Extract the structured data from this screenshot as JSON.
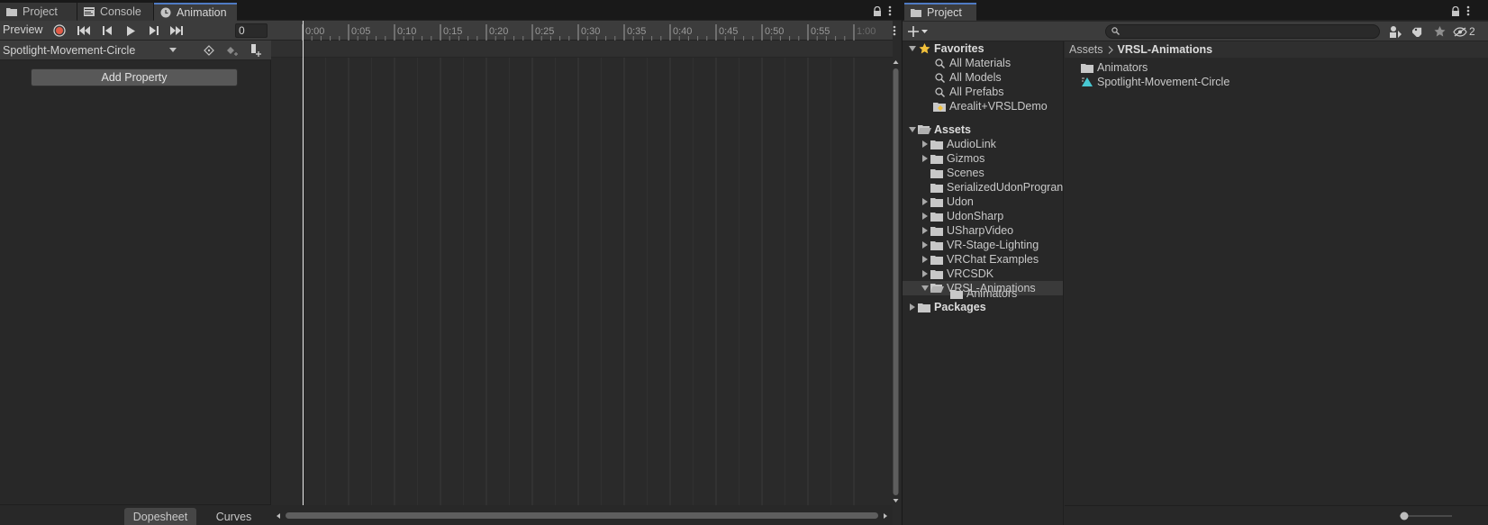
{
  "animation_window": {
    "tabs": [
      {
        "label": "Project",
        "icon": "folder-icon"
      },
      {
        "label": "Console",
        "icon": "console-icon"
      },
      {
        "label": "Animation",
        "icon": "clock-icon"
      }
    ],
    "preview_label": "Preview",
    "frame_value": "0",
    "clip_name": "Spotlight-Movement-Circle",
    "add_property_label": "Add Property",
    "bottom_tabs": [
      "Dopesheet",
      "Curves"
    ],
    "ruler_ticks": [
      "0:00",
      "0:05",
      "0:10",
      "0:15",
      "0:20",
      "0:25",
      "0:30",
      "0:35",
      "0:40",
      "0:45",
      "0:50",
      "0:55",
      "1:00"
    ],
    "record_color": "#e15a46"
  },
  "project_window": {
    "tab_label": "Project",
    "hidden_count": "2",
    "favorites_label": "Favorites",
    "favorites": [
      "All Materials",
      "All Models",
      "All Prefabs",
      "Arealit+VRSLDemo"
    ],
    "assets_label": "Assets",
    "assets_children": [
      {
        "label": "AudioLink",
        "foldout": "closed"
      },
      {
        "label": "Gizmos",
        "foldout": "closed"
      },
      {
        "label": "Scenes",
        "foldout": "none"
      },
      {
        "label": "SerializedUdonProgran",
        "foldout": "none"
      },
      {
        "label": "Udon",
        "foldout": "closed"
      },
      {
        "label": "UdonSharp",
        "foldout": "closed"
      },
      {
        "label": "USharpVideo",
        "foldout": "closed"
      },
      {
        "label": "VR-Stage-Lighting",
        "foldout": "closed"
      },
      {
        "label": "VRChat Examples",
        "foldout": "closed"
      },
      {
        "label": "VRCSDK",
        "foldout": "closed"
      },
      {
        "label": "VRSL-Animations",
        "foldout": "open"
      }
    ],
    "vrsl_child": "Animators",
    "packages_label": "Packages",
    "breadcrumb": [
      "Assets",
      "VRSL-Animations"
    ],
    "content_items": [
      {
        "label": "Animators",
        "icon": "folder-icon"
      },
      {
        "label": "Spotlight-Movement-Circle",
        "icon": "animation-clip-icon"
      }
    ]
  }
}
